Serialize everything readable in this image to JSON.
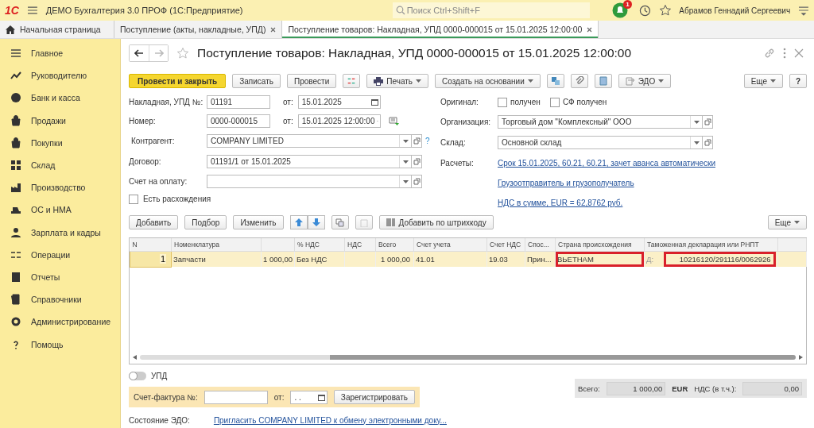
{
  "app": {
    "logo": "1С",
    "title": "ДЕМО Бухгалтерия 3.0 ПРОФ  (1С:Предприятие)",
    "search_placeholder": "Поиск Ctrl+Shift+F",
    "notification_count": "1",
    "user": "Абрамов Геннадий Сергеевич"
  },
  "tabs": [
    {
      "label": "Начальная страница",
      "selected": false,
      "closable": false,
      "home": true
    },
    {
      "label": "Поступление (акты, накладные, УПД)",
      "selected": false,
      "closable": true,
      "home": false
    },
    {
      "label": "Поступление товаров: Накладная, УПД 0000-000015 от 15.01.2025 12:00:00",
      "selected": true,
      "closable": true,
      "home": false
    }
  ],
  "sidebar": [
    "Главное",
    "Руководителю",
    "Банк и касса",
    "Продажи",
    "Покупки",
    "Склад",
    "Производство",
    "ОС и НМА",
    "Зарплата и кадры",
    "Операции",
    "Отчеты",
    "Справочники",
    "Администрирование",
    "Помощь"
  ],
  "document": {
    "title": "Поступление товаров: Накладная, УПД 0000-000015 от 15.01.2025 12:00:00",
    "toolbar": {
      "post_close": "Провести и закрыть",
      "save": "Записать",
      "post": "Провести",
      "print": "Печать",
      "create_based": "Создать на основании",
      "edo": "ЭДО",
      "more": "Еще",
      "help": "?"
    },
    "invoice_no": {
      "label": "Накладная, УПД №:",
      "value": "01191",
      "date_label": "от:",
      "date": "15.01.2025"
    },
    "number": {
      "label": "Номер:",
      "value": "0000-000015",
      "date_label": "от:",
      "date": "15.01.2025 12:00:00"
    },
    "counterparty": {
      "label": "Контрагент:",
      "value": "COMPANY LIMITED",
      "hint": "?"
    },
    "contract": {
      "label": "Договор:",
      "value": "01191/1 от 15.01.2025"
    },
    "payment_invoice": {
      "label": "Счет на оплату:"
    },
    "discrepancies": {
      "label": "Есть расхождения",
      "checked": false
    },
    "original": {
      "label": "Оригинал:",
      "checks": [
        {
          "label": "получен",
          "checked": false
        },
        {
          "label": "СФ получен",
          "checked": false
        }
      ]
    },
    "organization": {
      "label": "Организация:",
      "value": "Торговый дом \"Комплексный\" ООО"
    },
    "warehouse": {
      "label": "Склад:",
      "value": "Основной склад"
    },
    "settlements": {
      "label": "Расчеты:",
      "links": [
        "Срок 15.01.2025, 60.21, 60.21, зачет аванса автоматически",
        "Грузоотправитель и грузополучатель",
        "НДС в сумме, EUR = 62,8762 руб."
      ]
    },
    "table_toolbar": {
      "add": "Добавить",
      "pick": "Подбор",
      "edit": "Изменить",
      "barcode": "Добавить по штрихкоду",
      "more": "Еще"
    },
    "table": {
      "columns": [
        {
          "label": "N"
        },
        {
          "label": "Номенклатура"
        },
        {},
        {
          "label": "% НДС"
        },
        {
          "label": "НДС"
        },
        {
          "label": "Всего"
        },
        {
          "label": "Счет учета"
        },
        {
          "label": "Счет НДС"
        },
        {
          "label": "Спос..."
        },
        {
          "label": "Страна происхождения"
        },
        {
          "label": "Таможенная декларация или РНПТ"
        },
        {}
      ],
      "rows": [
        {
          "selected": true,
          "cells": [
            {
              "text": "1",
              "highlighted": false
            },
            {
              "text": "Запчасти",
              "highlighted": false
            },
            {
              "text": "1 000,00",
              "highlighted": false
            },
            {
              "text": "Без НДС",
              "highlighted": false
            },
            {
              "highlighted": false
            },
            {
              "text": "1 000,00",
              "highlighted": false
            },
            {
              "text": "41.01",
              "highlighted": false
            },
            {
              "text": "19.03",
              "highlighted": false
            },
            {
              "text": "Прин...",
              "highlighted": false
            },
            {
              "text": "ВЬЕТНАМ",
              "highlighted": true
            },
            {
              "prefix": "Д:",
              "text": "10216120/291116/0062926",
              "highlighted": true
            },
            {
              "highlighted": false
            }
          ]
        }
      ]
    },
    "upd": {
      "label": "УПД",
      "on": false
    },
    "totals": {
      "total_label": "Всего:",
      "total": "1 000,00",
      "currency": "EUR",
      "vat_label": "НДС (в т.ч.):",
      "vat": "0,00"
    },
    "invoice": {
      "label": "Счет-фактура №:",
      "date_label": "от:",
      "date_mask": " .  . ",
      "register": "Зарегистрировать"
    },
    "edo_state": {
      "label": "Состояние ЭДО:",
      "link": "Пригласить COMPANY LIMITED к обмену электронными доку..."
    }
  }
}
